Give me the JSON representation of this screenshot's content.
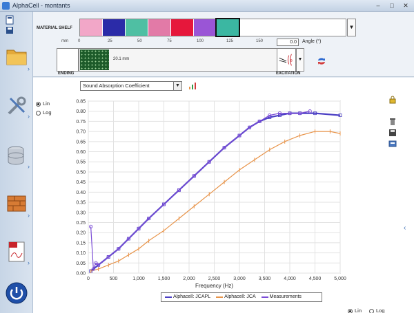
{
  "window": {
    "title": "AlphaCell - montants",
    "minimize": "–",
    "maximize": "□",
    "close": "✕"
  },
  "material_shelf": {
    "label": "MATERIAL SHELF",
    "swatches": [
      "#f2a7c8",
      "#2b2ba8",
      "#4fbfa3",
      "#e27aa7",
      "#e6173b",
      "#9a55d6",
      "#3bb7a2"
    ]
  },
  "ruler": {
    "unit": "mm",
    "ticks": [
      "0",
      "25",
      "50",
      "75",
      "100",
      "125",
      "150"
    ]
  },
  "angle": {
    "value": "0.0",
    "label": "Angle (°)"
  },
  "layers": {
    "ending_label": "ENDING",
    "thickness": "20.1 mm",
    "excitation_label": "EXCITATION"
  },
  "indicator": {
    "selected": "Sound Absorption Coefficient"
  },
  "scale_top": {
    "lin": "Lin",
    "log": "Log",
    "selected": "lin"
  },
  "scale_bottom": {
    "lin": "Lin",
    "log": "Log",
    "selected": "lin"
  },
  "colors": {
    "series_jcapl": "#4b3fc4",
    "series_jca": "#e8944a",
    "series_meas": "#7b4cd6"
  },
  "chart_data": {
    "type": "line",
    "xlabel": "Frequency (Hz)",
    "ylabel": "",
    "xlim": [
      0,
      5000
    ],
    "ylim": [
      0,
      0.85
    ],
    "xticks": [
      "0",
      "500",
      "1,000",
      "1,500",
      "2,000",
      "2,500",
      "3,000",
      "3,500",
      "4,000",
      "4,500",
      "5,000"
    ],
    "yticks": [
      "0.00",
      "0.05",
      "0.10",
      "0.15",
      "0.20",
      "0.25",
      "0.30",
      "0.35",
      "0.40",
      "0.45",
      "0.50",
      "0.55",
      "0.60",
      "0.65",
      "0.70",
      "0.75",
      "0.80",
      "0.85"
    ],
    "grid": true,
    "legend_position": "bottom",
    "series": [
      {
        "name": "Alphacell: JCAPL",
        "x": [
          50,
          200,
          400,
          600,
          800,
          1000,
          1200,
          1500,
          1800,
          2100,
          2400,
          2700,
          3000,
          3200,
          3400,
          3600,
          3800,
          4000,
          4200,
          4500,
          5000
        ],
        "y": [
          0.01,
          0.04,
          0.08,
          0.12,
          0.17,
          0.22,
          0.27,
          0.34,
          0.41,
          0.48,
          0.55,
          0.62,
          0.68,
          0.72,
          0.75,
          0.77,
          0.78,
          0.79,
          0.79,
          0.79,
          0.78
        ]
      },
      {
        "name": "Alphacell: JCA",
        "x": [
          50,
          200,
          400,
          600,
          800,
          1000,
          1200,
          1500,
          1800,
          2100,
          2400,
          2700,
          3000,
          3300,
          3600,
          3900,
          4200,
          4500,
          4800,
          5000
        ],
        "y": [
          0.01,
          0.02,
          0.04,
          0.06,
          0.09,
          0.12,
          0.16,
          0.21,
          0.27,
          0.33,
          0.39,
          0.45,
          0.51,
          0.56,
          0.61,
          0.65,
          0.68,
          0.7,
          0.7,
          0.69
        ]
      },
      {
        "name": "Measurements",
        "x": [
          50,
          100,
          150,
          200,
          400,
          600,
          800,
          1000,
          1200,
          1500,
          1800,
          2100,
          2400,
          2700,
          3000,
          3200,
          3400,
          3600,
          3800,
          4000,
          4200,
          4400
        ],
        "y": [
          0.23,
          0.02,
          0.05,
          0.04,
          0.08,
          0.12,
          0.17,
          0.22,
          0.27,
          0.34,
          0.41,
          0.48,
          0.55,
          0.62,
          0.68,
          0.72,
          0.75,
          0.78,
          0.79,
          0.79,
          0.79,
          0.8
        ]
      }
    ]
  }
}
